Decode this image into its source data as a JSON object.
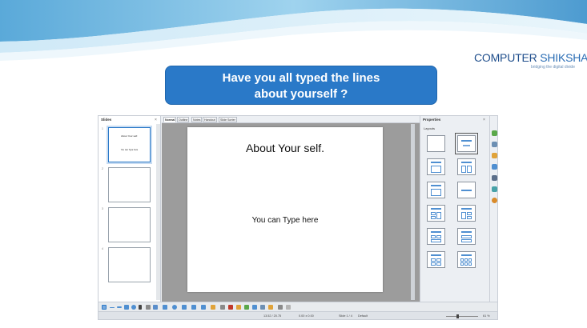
{
  "logo": {
    "text_a": "COMPUTER",
    "text_b": " SHIKSHA",
    "tagline": "bridging the digital divide"
  },
  "banner": {
    "line1": "Have you all typed the lines",
    "line2": "about yourself ?"
  },
  "app": {
    "slides_panel": {
      "title": "Slides",
      "close": "×",
      "numbers": [
        "1",
        "2",
        "3",
        "4"
      ]
    },
    "tabs": [
      "Normal",
      "Outline",
      "Notes",
      "Handout",
      "Slide Sorter"
    ],
    "slide": {
      "title": "About Your self.",
      "body": "You can Type here"
    },
    "thumb1": {
      "title": "About Your self.",
      "body": "You can Type here"
    },
    "properties": {
      "title": "Properties",
      "close": "×",
      "section": "Layouts"
    },
    "status": {
      "position": "13.52 / 20.75",
      "size": "0.00 x 0.00",
      "slide": "Slide 1 / 4",
      "master": "Default",
      "zoom": "61 %"
    }
  },
  "colors": {
    "banner": "#2a79c8",
    "accent": "#4f8fd1",
    "logo": "#1f4e8c"
  },
  "icons": {
    "sidebar": [
      "properties-icon",
      "styles-icon",
      "gallery-icon",
      "navigator-icon",
      "master-slides-icon",
      "animation-icon",
      "slide-transition-icon"
    ]
  }
}
